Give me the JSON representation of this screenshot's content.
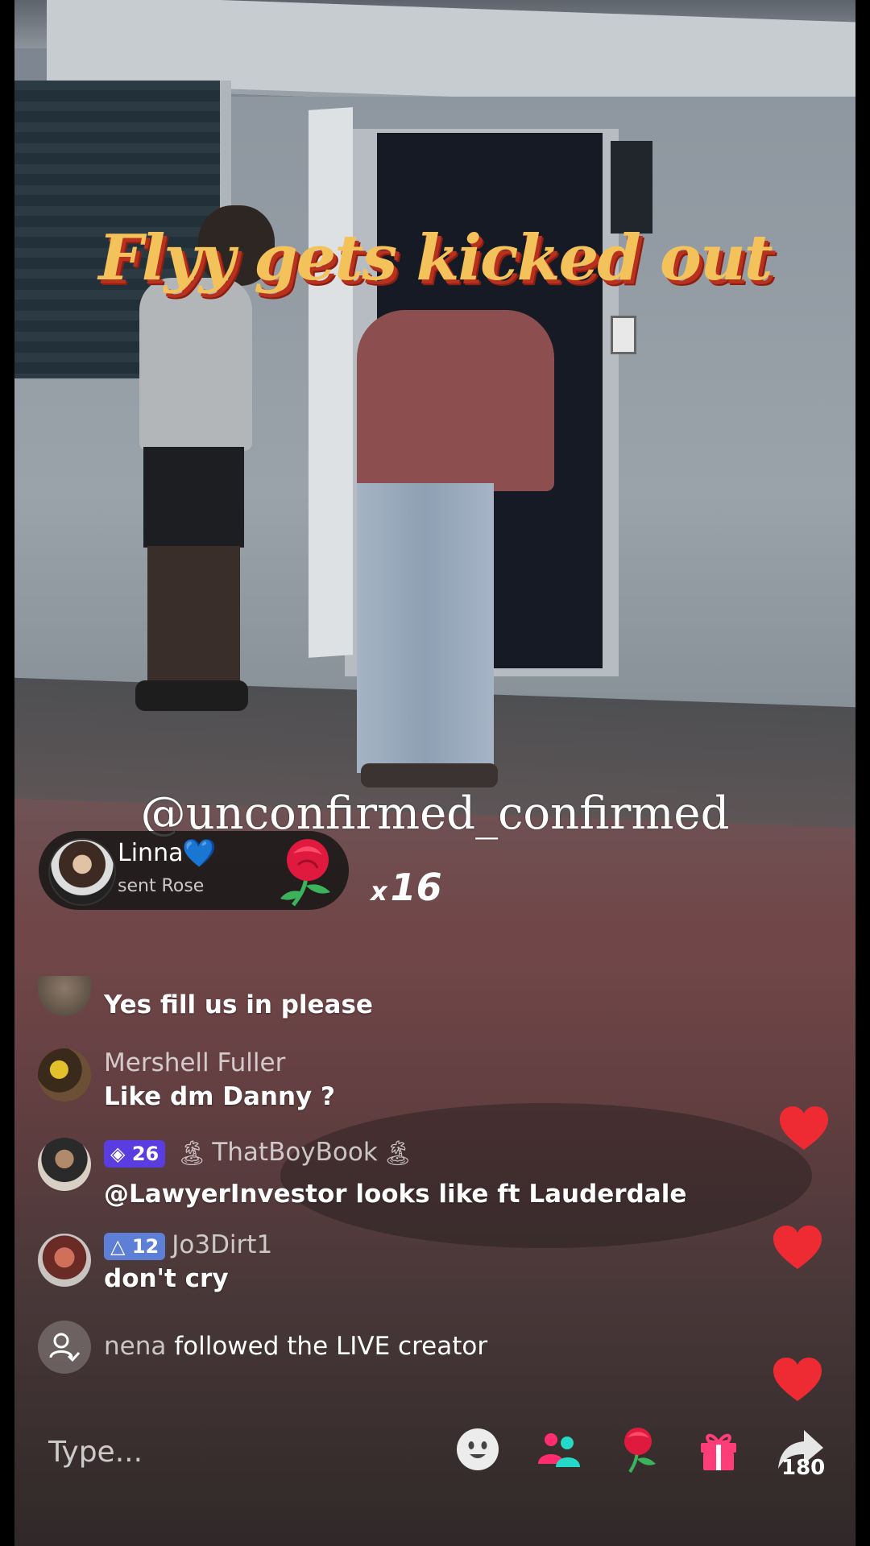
{
  "overlay": {
    "title": "Flyy gets kicked out",
    "watermark": "@unconfirmed_confirmed"
  },
  "gift": {
    "sender": "Linna",
    "heart": "💙",
    "action": "sent Rose",
    "gift_icon": "rose-icon",
    "count_prefix": "x",
    "count": "16"
  },
  "comments": [
    {
      "name": "",
      "text": "Yes fill us in please"
    },
    {
      "name": "Mershell Fuller",
      "text": "Like dm Danny ?"
    },
    {
      "badge": "26",
      "badge_icon": "diamond-icon",
      "name": "ThatBoyBook",
      "text": "@LawyerInvestor looks like ft Lauderdale"
    },
    {
      "badge": "12",
      "badge_icon": "triangle-icon",
      "name": "Jo3Dirt1",
      "text": "don't cry"
    }
  ],
  "follow_event": {
    "user": "nena",
    "text": "followed the LIVE creator"
  },
  "bottom_bar": {
    "placeholder": "Type...",
    "share_count": "180"
  },
  "colors": {
    "title": "#f3c25b",
    "title_shadow": "#b8311e",
    "heart": "#ee2a33",
    "gift_accent": "#ff2d6f"
  }
}
